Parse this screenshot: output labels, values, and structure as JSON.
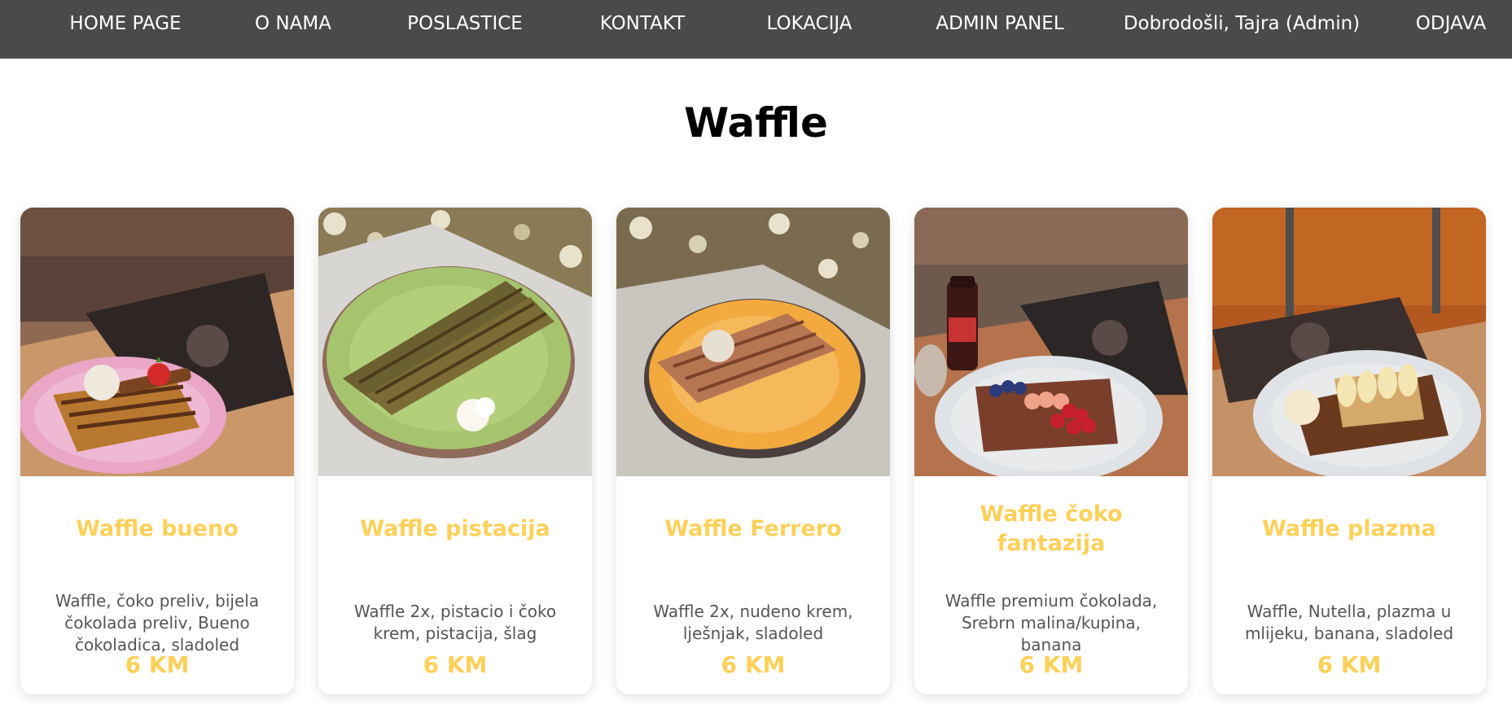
{
  "nav": {
    "items": [
      {
        "label": "HOME PAGE"
      },
      {
        "label": "O NAMA"
      },
      {
        "label": "POSLASTICE"
      },
      {
        "label": "KONTAKT"
      },
      {
        "label": "LOKACIJA"
      },
      {
        "label": "ADMIN PANEL"
      },
      {
        "label": "Dobrodošli, Tajra (Admin)"
      },
      {
        "label": "ODJAVA"
      }
    ]
  },
  "page": {
    "title": "Waffle"
  },
  "products": [
    {
      "name": "Waffle bueno",
      "description": "Waffle, čoko preliv, bijela čokolada preliv, Bueno čokoladica, sladoled",
      "price": "6 KM",
      "plate_color": "#e9a6c6"
    },
    {
      "name": "Waffle pistacija",
      "description": "Waffle 2x, pistacio i čoko krem, pistacija, šlag",
      "price": "6 KM",
      "plate_color": "#a6c46e"
    },
    {
      "name": "Waffle Ferrero",
      "description": "Waffle 2x, nudeno krem, lješnjak, sladoled",
      "price": "6 KM",
      "plate_color": "#f2a93e"
    },
    {
      "name": "Waffle čoko fantazija",
      "description": "Waffle premium čokolada, Srebrn malina/kupina, banana",
      "price": "6 KM",
      "plate_color": "#dfe2e6"
    },
    {
      "name": "Waffle plazma",
      "description": "Waffle, Nutella, plazma u mlijeku, banana, sladoled",
      "price": "6 KM",
      "plate_color": "#dfe2e6"
    }
  ],
  "colors": {
    "nav_background": "#4a4a4a",
    "accent": "#fdd05a",
    "text_muted": "#555555"
  }
}
